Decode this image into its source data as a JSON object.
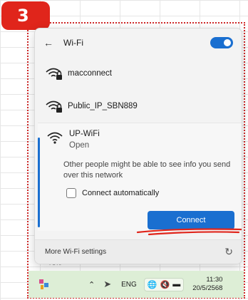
{
  "badge": {
    "step": "3"
  },
  "wifi_panel": {
    "title": "Wi-Fi",
    "toggle_on": true,
    "networks": [
      {
        "name": "macconnect",
        "secured": true
      },
      {
        "name": "Public_IP_SBN889",
        "secured": true
      }
    ],
    "expanded": {
      "name": "UP-WiFi",
      "status": "Open",
      "warning": "Other people might be able to see info you send over this network",
      "auto_connect_label": "Connect automatically",
      "auto_connect_checked": false,
      "connect_label": "Connect"
    },
    "footer": {
      "settings_label": "More Wi-Fi settings"
    }
  },
  "taskbar": {
    "language": "ENG",
    "time": "11:30",
    "date": "20/5/2568"
  },
  "colors": {
    "accent": "#1a6fd0",
    "badge": "#e0251b",
    "annotation": "#d02a2a",
    "taskbar": "#ddeed6"
  }
}
